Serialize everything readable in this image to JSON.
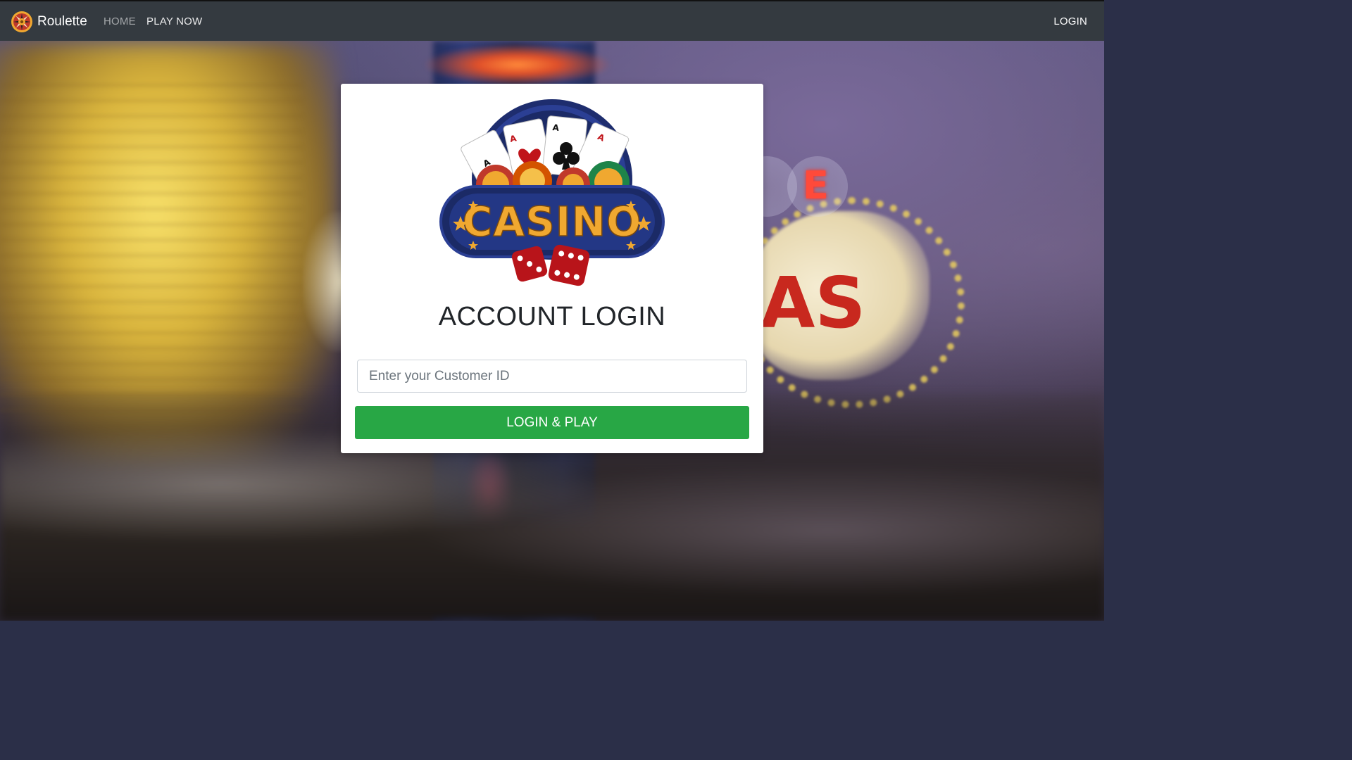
{
  "navbar": {
    "brand": "Roulette",
    "links": [
      {
        "label": "HOME"
      },
      {
        "label": "PLAY NOW"
      }
    ],
    "login_label": "LOGIN"
  },
  "login_card": {
    "logo_text": "CASINO",
    "title": "ACCOUNT LOGIN",
    "customer_id": {
      "value": "",
      "placeholder": "Enter your Customer ID"
    },
    "submit_label": "LOGIN & PLAY"
  },
  "background": {
    "sign_letters": [
      "AS",
      "E"
    ]
  },
  "colors": {
    "navbar": "#343a40",
    "button": "#28a745",
    "logo_navy": "#1e2d6e",
    "logo_gold": "#f0a830",
    "dice_red": "#b8141a"
  },
  "icons": [
    "roulette-wheel-icon",
    "casino-logo"
  ]
}
